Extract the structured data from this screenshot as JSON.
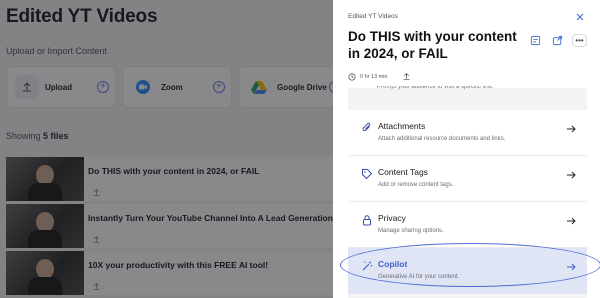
{
  "library": {
    "title": "Edited YT Videos",
    "import_section": "Upload or Import Content",
    "import_options": [
      {
        "label": "Upload",
        "icon": "upload-icon"
      },
      {
        "label": "Zoom",
        "icon": "zoom-icon"
      },
      {
        "label": "Google Drive",
        "icon": "google-drive-icon"
      }
    ],
    "showing_prefix": "Showing",
    "showing_count": "5 files",
    "files": [
      {
        "title": "Do THIS with your content in 2024, or FAIL"
      },
      {
        "title": "Instantly Turn Your YouTube Channel Into A Lead Generation Mac"
      },
      {
        "title": "10X your productivity with this FREE AI tool!"
      }
    ]
  },
  "panel": {
    "breadcrumb": "Edited YT Videos",
    "title": "Do THIS with your content in 2024, or FAIL",
    "duration": "0 hr 13 min",
    "cut_text": "Prompt your audience to visit a specific link.",
    "items": [
      {
        "title": "Attachments",
        "desc": "Attach additional resource documents and links.",
        "icon": "paperclip-icon"
      },
      {
        "title": "Content Tags",
        "desc": "Add or remove content tags.",
        "icon": "tag-icon"
      },
      {
        "title": "Privacy",
        "desc": "Manage sharing options.",
        "icon": "lock-icon"
      },
      {
        "title": "Copilot",
        "desc": "Generative AI for your content.",
        "icon": "magic-wand-icon"
      }
    ],
    "more_label": "•••"
  },
  "colors": {
    "accent": "#4f6fd3",
    "copilot_bg": "#dfe5f5",
    "overlay": "rgba(20,20,24,0.50)"
  }
}
